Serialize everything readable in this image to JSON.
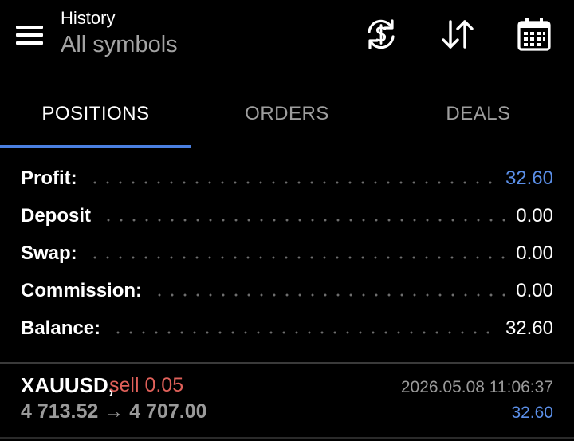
{
  "header": {
    "title": "History",
    "subtitle": "All symbols",
    "icons": [
      "menu-icon",
      "currency-exchange-icon",
      "sort-arrows-icon",
      "calendar-icon"
    ]
  },
  "tabs": [
    {
      "label": "POSITIONS",
      "active": true
    },
    {
      "label": "ORDERS",
      "active": false
    },
    {
      "label": "DEALS",
      "active": false
    }
  ],
  "summary": [
    {
      "label": "Profit:",
      "value": "32.60"
    },
    {
      "label": "Deposit",
      "value": "0.00"
    },
    {
      "label": "Swap:",
      "value": "0.00"
    },
    {
      "label": "Commission:",
      "value": "0.00"
    },
    {
      "label": "Balance:",
      "value": "32.60"
    }
  ],
  "deals": [
    {
      "symbol": "XAUUSD,",
      "side": "sell 0.05",
      "prices": "4 713.52 → 4 707.00",
      "time": "2026.05.08 11:06:37",
      "profit": "32.60"
    }
  ],
  "colors": {
    "background": "#000000",
    "accent": "#4a7fe0",
    "profit": "#5b8fe8",
    "sell": "#e0615a",
    "muted": "#9a9a9a"
  }
}
